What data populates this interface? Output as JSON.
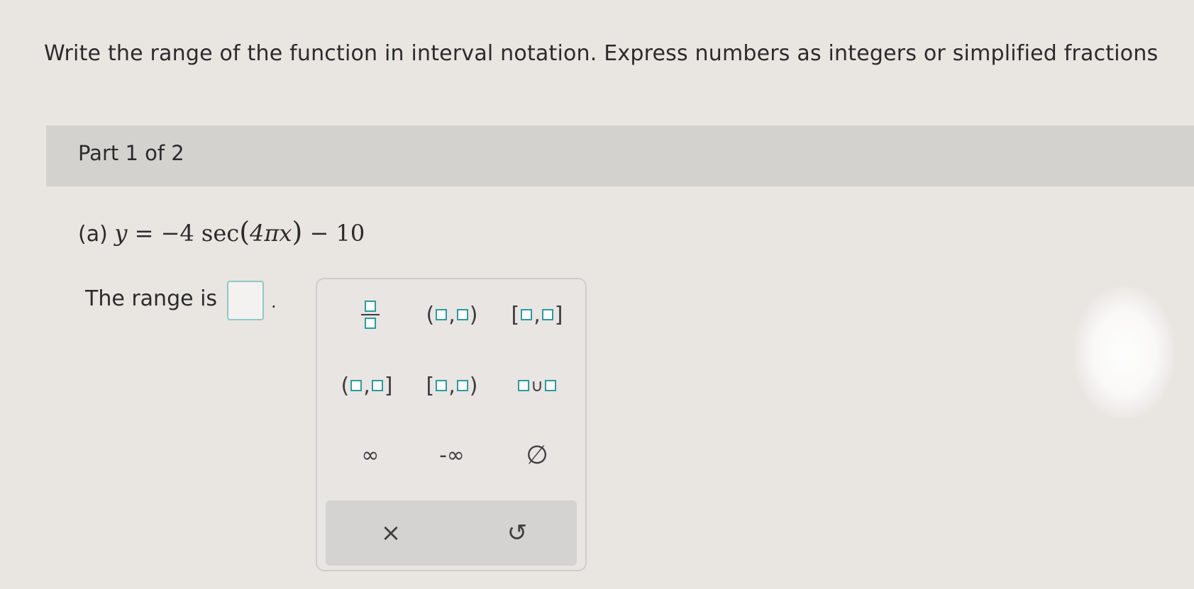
{
  "instructions": "Write the range of the function in interval notation. Express numbers as integers or simplified fractions",
  "part": {
    "label": "Part 1 of 2"
  },
  "question": {
    "label": "(a)",
    "lhs": "y",
    "equals": "=",
    "coef": "−4",
    "func": "sec",
    "open_paren": "(",
    "arg": "4πx",
    "close_paren": ")",
    "minus": "−",
    "constant": "10"
  },
  "answer": {
    "prompt": "The range is",
    "value": "",
    "period": "."
  },
  "palette": {
    "keys": [
      {
        "name": "fraction",
        "type": "fraction"
      },
      {
        "name": "open-interval",
        "left": "(",
        "sep": ",",
        "right": ")"
      },
      {
        "name": "closed-interval",
        "left": "[",
        "sep": ",",
        "right": "]"
      },
      {
        "name": "left-open-right-closed",
        "left": "(",
        "sep": ",",
        "right": "]"
      },
      {
        "name": "left-closed-right-open",
        "left": "[",
        "sep": ",",
        "right": ")"
      },
      {
        "name": "union",
        "sep": "∪"
      },
      {
        "name": "infinity",
        "text": "∞"
      },
      {
        "name": "negative-infinity",
        "text": "-∞"
      },
      {
        "name": "empty-set",
        "text": "∅"
      }
    ],
    "clear_icon": "×",
    "undo_icon": "↺"
  },
  "colors": {
    "accent": "#2e9aa0",
    "header_bg": "#d4d2cf",
    "action_bar_bg": "#d5d3d1"
  }
}
